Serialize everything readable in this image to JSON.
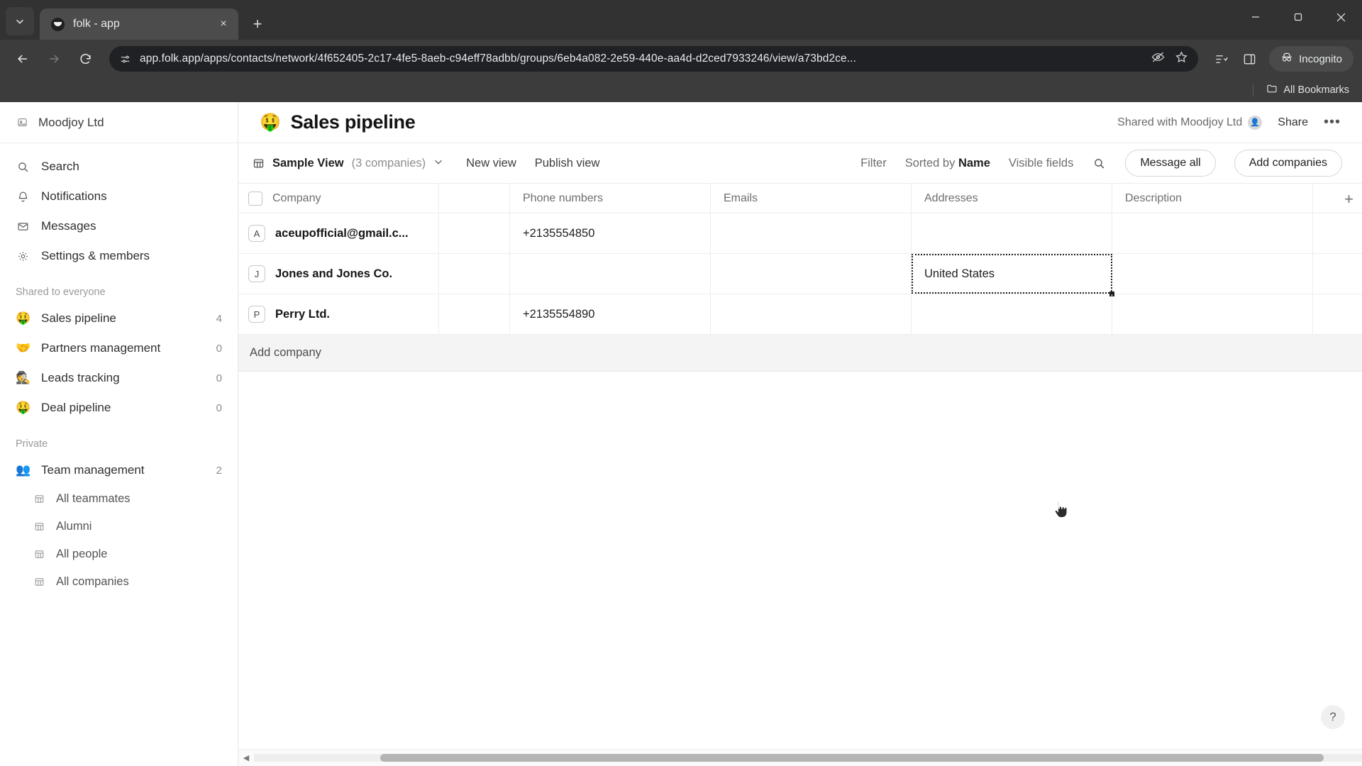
{
  "browser": {
    "tab": {
      "title": "folk - app",
      "favicon": "folk-logo-icon",
      "close_label": "×"
    },
    "new_tab_label": "+",
    "tab_search_icon": "chevron-down-icon",
    "window_controls": {
      "minimize": "—",
      "maximize": "▢",
      "close": "✕"
    },
    "nav": {
      "back": "back-arrow-icon",
      "forward": "forward-arrow-icon",
      "reload": "reload-icon"
    },
    "omnibox": {
      "site_icon": "site-settings-icon",
      "url": "app.folk.app/apps/contacts/network/4f652405-2c17-4fe5-8aeb-c94eff78adbb/groups/6eb4a082-2e59-440e-aa4d-d2ced7933246/view/a73bd2ce...",
      "tracking_icon": "eye-crossed-icon",
      "bookmark_icon": "star-icon"
    },
    "toolbar_icons": [
      "reading-list-icon",
      "side-panel-icon"
    ],
    "profile": {
      "label": "Incognito",
      "icon": "incognito-icon"
    },
    "bookmarks": {
      "all_bookmarks_label": "All Bookmarks",
      "folder_icon": "folder-icon"
    }
  },
  "sidebar": {
    "workspace": {
      "name": "Moodjoy Ltd",
      "icon": "workspace-logo-icon"
    },
    "nav": [
      {
        "label": "Search",
        "icon": "search-icon"
      },
      {
        "label": "Notifications",
        "icon": "bell-icon"
      },
      {
        "label": "Messages",
        "icon": "envelope-icon"
      },
      {
        "label": "Settings & members",
        "icon": "gear-icon"
      }
    ],
    "shared_section": {
      "label": "Shared to everyone",
      "items": [
        {
          "emoji": "🤑",
          "label": "Sales pipeline",
          "count": "4"
        },
        {
          "emoji": "🤝",
          "label": "Partners management",
          "count": "0"
        },
        {
          "emoji": "🕵️",
          "label": "Leads tracking",
          "count": "0"
        },
        {
          "emoji": "🤑",
          "label": "Deal pipeline",
          "count": "0"
        }
      ]
    },
    "private_section": {
      "label": "Private",
      "items": [
        {
          "emoji": "👥",
          "label": "Team management",
          "count": "2"
        }
      ],
      "sub_items": [
        {
          "label": "All teammates",
          "icon": "table-icon"
        },
        {
          "label": "Alumni",
          "icon": "table-icon"
        },
        {
          "label": "All people",
          "icon": "table-icon"
        },
        {
          "label": "All companies",
          "icon": "table-icon"
        }
      ]
    }
  },
  "header": {
    "emoji": "🤑",
    "title": "Sales pipeline",
    "shared_with": "Shared with Moodjoy Ltd",
    "shared_avatar": "👤",
    "share_label": "Share",
    "more_label": "•••"
  },
  "view_bar": {
    "view_icon": "table-icon",
    "view_name": "Sample View",
    "view_count": "(3 companies)",
    "chevron": "chevron-down-icon",
    "new_view": "New view",
    "publish_view": "Publish view",
    "filter": "Filter",
    "sorted_by_prefix": "Sorted by ",
    "sorted_by_field": "Name",
    "visible_fields": "Visible fields",
    "search_icon": "search-icon",
    "message_all": "Message all",
    "add_companies": "Add companies"
  },
  "table": {
    "columns": [
      "Company",
      "",
      "Phone numbers",
      "Emails",
      "Addresses",
      "Description"
    ],
    "add_column_label": "+",
    "rows": [
      {
        "initial": "A",
        "company": "aceupofficial@gmail.c...",
        "extra": "",
        "phone": "+2135554850",
        "email": "",
        "address": "",
        "description": ""
      },
      {
        "initial": "J",
        "company": "Jones and Jones Co.",
        "extra": "",
        "phone": "",
        "email": "",
        "address": "United States",
        "description": ""
      },
      {
        "initial": "P",
        "company": "Perry Ltd.",
        "extra": "",
        "phone": "+2135554890",
        "email": "",
        "address": "",
        "description": ""
      }
    ],
    "selected_cell": {
      "row": 1,
      "column": "Addresses",
      "value": "United States"
    },
    "add_company_label": "Add company"
  },
  "footer": {
    "help_label": "?"
  }
}
